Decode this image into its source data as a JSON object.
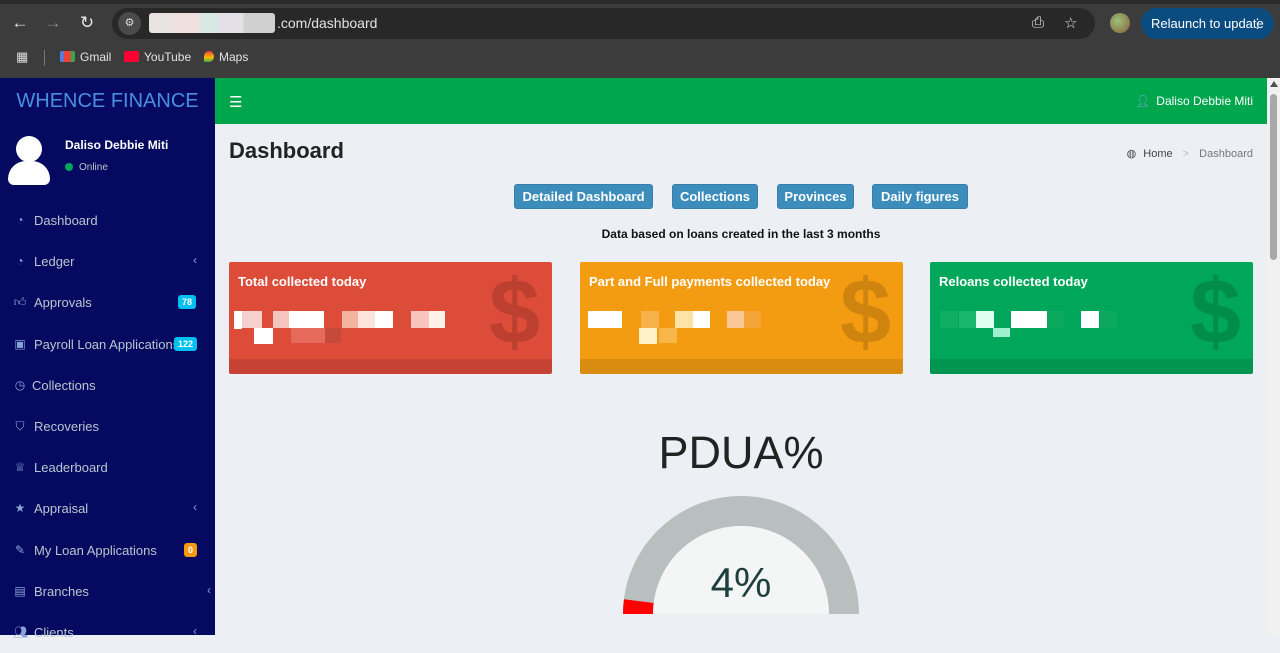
{
  "browser": {
    "url_suffix": ".com/dashboard",
    "relaunch_label": "Relaunch to update",
    "bookmarks": [
      {
        "label": "Gmail",
        "icon": "gmail-icon"
      },
      {
        "label": "YouTube",
        "icon": "youtube-icon"
      },
      {
        "label": "Maps",
        "icon": "maps-icon"
      }
    ]
  },
  "sidebar": {
    "brand": "WHENCE FINANCE",
    "user": {
      "name": "Daliso Debbie Miti",
      "status": "Online"
    },
    "items": [
      {
        "label": "Dashboard",
        "icon": "dashboard-icon"
      },
      {
        "label": "Ledger",
        "icon": "ledger-icon",
        "has_submenu": true
      },
      {
        "label": "Approvals",
        "icon": "thumbs-up-icon",
        "badge": "78",
        "badge_color": "#00c0ef"
      },
      {
        "label": "Payroll Loan Applications",
        "icon": "money-icon",
        "badge": "122",
        "badge_color": "#00c0ef"
      },
      {
        "label": "Collections",
        "icon": "clock-icon"
      },
      {
        "label": "Recoveries",
        "icon": "shield-icon"
      },
      {
        "label": "Leaderboard",
        "icon": "trophy-icon"
      },
      {
        "label": "Appraisal",
        "icon": "star-icon",
        "has_submenu": true
      },
      {
        "label": "My Loan Applications",
        "icon": "pencil-icon",
        "badge": "0",
        "badge_color": "#f39c12"
      },
      {
        "label": "Branches",
        "icon": "branches-icon",
        "has_submenu": true
      },
      {
        "label": "Clients",
        "icon": "users-icon",
        "has_submenu": true
      }
    ]
  },
  "header": {
    "user_name": "Daliso Debbie Miti"
  },
  "main": {
    "title": "Dashboard",
    "breadcrumb": {
      "home": "Home",
      "current": "Dashboard"
    },
    "buttons": [
      "Detailed Dashboard",
      "Collections",
      "Provinces",
      "Daily figures"
    ],
    "range_note": "Data based on loans created in the last 3 months",
    "boxes": [
      {
        "title": "Total collected today",
        "color": "#dd4b39",
        "icon": "$"
      },
      {
        "title": "Part and Full payments collected today",
        "color": "#f39c12",
        "icon": "$"
      },
      {
        "title": "Reloans collected today",
        "color": "#00a65a",
        "icon": "$"
      }
    ],
    "pdua": {
      "title": "PDUA%",
      "value_label": "4%",
      "fraction": 0.04,
      "fill_color": "#ff0000",
      "track_color": "#b8bfbe"
    }
  }
}
